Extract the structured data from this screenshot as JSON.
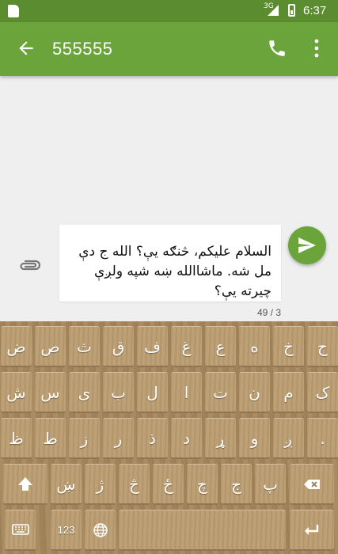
{
  "status_bar": {
    "network": "3G",
    "time": "6:37"
  },
  "app_bar": {
    "title": "555555"
  },
  "message": {
    "text": "السلام علیکم، څنګه یې؟ الله ج دې مل شه. ماشاالله ښه شپه ولږې چیرته یې؟",
    "counter": "49 / 3"
  },
  "keyboard": {
    "row1": [
      "ح",
      "خ",
      "ه",
      "ع",
      "غ",
      "ف",
      "ق",
      "ث",
      "ص",
      "ض"
    ],
    "row2": [
      "ک",
      "م",
      "ن",
      "ت",
      "ا",
      "ل",
      "ب",
      "ی",
      "س",
      "ش"
    ],
    "row3": [
      ".",
      "ږ",
      "و",
      "ړ",
      "د",
      "ذ",
      "ر",
      "ز",
      "ط",
      "ظ"
    ],
    "row4": [
      "پ",
      "ج",
      "چ",
      "ځ",
      "څ",
      "ژ",
      "ښ"
    ],
    "numbers_label": "123"
  },
  "colors": {
    "status_bar": "#5b8c2f",
    "app_bar": "#6ba43a",
    "accent": "#6ba43a",
    "keyboard_wood": "#a7875c"
  }
}
